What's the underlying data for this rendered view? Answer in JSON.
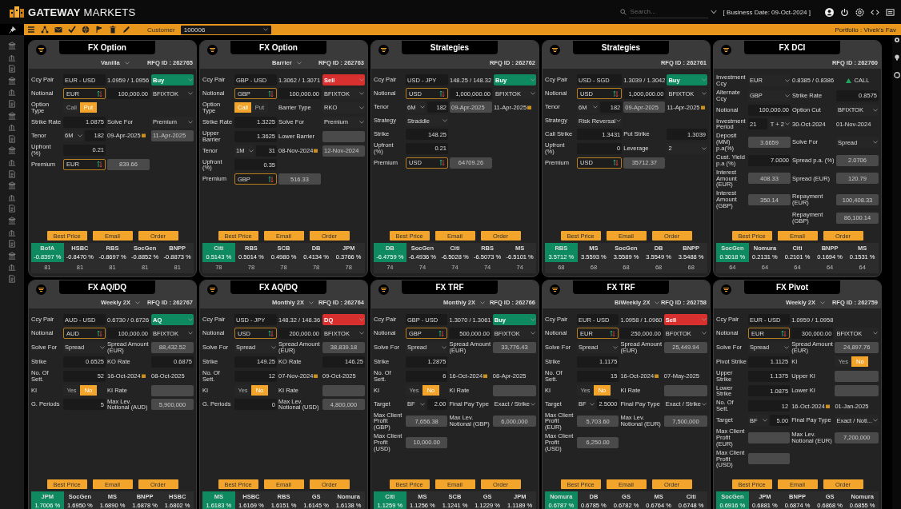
{
  "app": {
    "brand": "**GATEWAY** MARKETS",
    "search": {
      "placeholder": "Search..."
    },
    "business_date": "[ Business Date: 09-Oct-2024 ]"
  },
  "toolbar": {
    "customer_label": "Customer",
    "customer_value": "100006",
    "portfolio": "Portfolio : Vivek's Fav"
  },
  "cards": [
    {
      "title": "FX Option",
      "subtitle": "Vanilla",
      "rfq": "RFQ ID : 262765",
      "rows": [
        [
          {
            "kind": "label",
            "text": "Ccy Pair"
          },
          {
            "kind": "pair",
            "value": "EUR - USD"
          },
          {
            "kind": "text",
            "value": "1.0959 / 1.0956"
          },
          {
            "kind": "side",
            "value": "Buy",
            "color": "#0f8a60"
          }
        ],
        [
          {
            "kind": "label",
            "text": "Notional"
          },
          {
            "kind": "ccy",
            "value": "EUR"
          },
          {
            "kind": "input",
            "value": "100,000.00"
          },
          {
            "kind": "select",
            "value": "BFIXTOK"
          }
        ],
        [
          {
            "kind": "label",
            "text": "Option Type"
          },
          {
            "kind": "toggle",
            "options": [
              {
                "label": "Call",
                "selected": false
              },
              {
                "label": "Put",
                "selected": true
              }
            ]
          }
        ],
        [
          {
            "kind": "label",
            "text": "Strike Rate"
          },
          {
            "kind": "input",
            "value": "1.0875"
          },
          {
            "kind": "label",
            "text": "Solve For"
          },
          {
            "kind": "select",
            "value": "Premium"
          }
        ],
        [
          {
            "kind": "label",
            "text": "Tenor"
          },
          {
            "kind": "group",
            "parts": [
              {
                "kind": "select",
                "value": "6M"
              },
              {
                "kind": "input",
                "value": "182"
              }
            ]
          },
          {
            "kind": "date",
            "value": "09-Apr-2025"
          },
          {
            "kind": "datebox",
            "value": "11-Apr-2025"
          }
        ],
        [
          {
            "kind": "label",
            "text": "Upfront (%)"
          },
          {
            "kind": "input",
            "value": "0.21"
          }
        ],
        [
          {
            "kind": "label",
            "text": "Premium"
          },
          {
            "kind": "ccy",
            "value": "EUR"
          },
          {
            "kind": "readonly",
            "value": "839.66"
          }
        ]
      ],
      "buttons": [
        "Best Price",
        "Email",
        "Order"
      ],
      "quotes": [
        {
          "bank": "BofA",
          "rate": "-0.8397 %",
          "count": "81",
          "selected": true
        },
        {
          "bank": "HSBC",
          "rate": "-0.8470 %",
          "count": "81",
          "selected": false
        },
        {
          "bank": "RBS",
          "rate": "-0.8697 %",
          "count": "81",
          "selected": false
        },
        {
          "bank": "SocGen",
          "rate": "-0.8852 %",
          "count": "81",
          "selected": false
        },
        {
          "bank": "BNPP",
          "rate": "-0.8873 %",
          "count": "81",
          "selected": false
        }
      ]
    },
    {
      "title": "FX Option",
      "subtitle": "Barrier",
      "rfq": "RFQ ID : 262763",
      "rows": [
        [
          {
            "kind": "label",
            "text": "Ccy Pair"
          },
          {
            "kind": "pair",
            "value": "GBP - USD"
          },
          {
            "kind": "text",
            "value": "1.3062 / 1.3071"
          },
          {
            "kind": "side",
            "value": "Sell",
            "color": "#d8302e"
          }
        ],
        [
          {
            "kind": "label",
            "text": "Notional"
          },
          {
            "kind": "ccy",
            "value": "GBP"
          },
          {
            "kind": "input",
            "value": "100,000.00"
          },
          {
            "kind": "select",
            "value": "BFIXTOK"
          }
        ],
        [
          {
            "kind": "label",
            "text": "Option Type"
          },
          {
            "kind": "toggle",
            "options": [
              {
                "label": "Call",
                "selected": true
              },
              {
                "label": "Put",
                "selected": false
              }
            ]
          },
          {
            "kind": "label",
            "text": "Barrier Type"
          },
          {
            "kind": "select",
            "value": "RKO"
          }
        ],
        [
          {
            "kind": "label",
            "text": "Strike Rate"
          },
          {
            "kind": "input",
            "value": "1.3225"
          },
          {
            "kind": "label",
            "text": "Solve For"
          },
          {
            "kind": "select",
            "value": "Premium"
          }
        ],
        [
          {
            "kind": "label",
            "text": "Upper Barrier"
          },
          {
            "kind": "input",
            "value": "1.3625"
          },
          {
            "kind": "label",
            "text": "Lower Barrier"
          },
          {
            "kind": "readonly"
          }
        ],
        [
          {
            "kind": "label",
            "text": "Tenor"
          },
          {
            "kind": "group",
            "parts": [
              {
                "kind": "select",
                "value": "1M"
              },
              {
                "kind": "input",
                "value": "31"
              }
            ]
          },
          {
            "kind": "date",
            "value": "08-Nov-2024"
          },
          {
            "kind": "datebox",
            "value": "12-Nov-2024"
          }
        ],
        [
          {
            "kind": "label",
            "text": "Upfront (%)"
          },
          {
            "kind": "input",
            "value": "0.35"
          }
        ],
        [
          {
            "kind": "label",
            "text": "Premium"
          },
          {
            "kind": "ccy",
            "value": "GBP"
          },
          {
            "kind": "readonly",
            "value": "516.33"
          }
        ]
      ],
      "buttons": [
        "Best Price",
        "Email",
        "Order"
      ],
      "quotes": [
        {
          "bank": "Citi",
          "rate": "0.5143 %",
          "count": "78",
          "selected": true
        },
        {
          "bank": "RBS",
          "rate": "0.5014 %",
          "count": "78",
          "selected": false
        },
        {
          "bank": "SCB",
          "rate": "0.4980 %",
          "count": "78",
          "selected": false
        },
        {
          "bank": "DB",
          "rate": "0.4134 %",
          "count": "78",
          "selected": false
        },
        {
          "bank": "JPM",
          "rate": "0.3766 %",
          "count": "78",
          "selected": false
        }
      ]
    },
    {
      "title": "Strategies",
      "rfq": "RFQ ID : 262762",
      "rows": [
        [
          {
            "kind": "label",
            "text": "Ccy Pair"
          },
          {
            "kind": "pair",
            "value": "USD - JPY"
          },
          {
            "kind": "text",
            "value": "148.25 / 148.32"
          },
          {
            "kind": "side",
            "value": "Buy",
            "color": "#0f8a60"
          }
        ],
        [
          {
            "kind": "label",
            "text": "Notional"
          },
          {
            "kind": "ccy",
            "value": "USD"
          },
          {
            "kind": "input",
            "value": "1,000,000.00"
          },
          {
            "kind": "select",
            "value": "BFIXTOK"
          }
        ],
        [
          {
            "kind": "label",
            "text": "Tenor"
          },
          {
            "kind": "group",
            "parts": [
              {
                "kind": "select",
                "value": "6M"
              },
              {
                "kind": "input",
                "value": "182"
              }
            ]
          },
          {
            "kind": "datebox",
            "value": "09-Apr-2025"
          },
          {
            "kind": "date",
            "value": "11-Apr-2025"
          }
        ],
        [
          {
            "kind": "label",
            "text": "Strategy"
          },
          {
            "kind": "select",
            "value": "Straddle"
          }
        ],
        [
          {
            "kind": "label",
            "text": "Strike"
          },
          {
            "kind": "input",
            "value": "148.25"
          }
        ],
        [
          {
            "kind": "label",
            "text": "Upfront (%)"
          },
          {
            "kind": "input",
            "value": "0.21"
          }
        ],
        [
          {
            "kind": "label",
            "text": "Premium"
          },
          {
            "kind": "ccy",
            "value": "USD"
          },
          {
            "kind": "readonly",
            "value": "64709.26"
          }
        ]
      ],
      "buttons": [
        "Best Price",
        "Email",
        "Order"
      ],
      "quotes": [
        {
          "bank": "DB",
          "rate": "-6.4759 %",
          "count": "74",
          "selected": true
        },
        {
          "bank": "SocGen",
          "rate": "-6.4936 %",
          "count": "74",
          "selected": false
        },
        {
          "bank": "Citi",
          "rate": "-6.5028 %",
          "count": "74",
          "selected": false
        },
        {
          "bank": "RBS",
          "rate": "-6.5073 %",
          "count": "74",
          "selected": false
        },
        {
          "bank": "MS",
          "rate": "-6.5101 %",
          "count": "74",
          "selected": false
        }
      ]
    },
    {
      "title": "Strategies",
      "rfq": "RFQ ID : 262761",
      "rows": [
        [
          {
            "kind": "label",
            "text": "Ccy Pair"
          },
          {
            "kind": "pair",
            "value": "USD - SGD"
          },
          {
            "kind": "text",
            "value": "1.3039 / 1.3042"
          },
          {
            "kind": "side",
            "value": "Buy",
            "color": "#0f8a60"
          }
        ],
        [
          {
            "kind": "label",
            "text": "Notional"
          },
          {
            "kind": "ccy",
            "value": "USD"
          },
          {
            "kind": "input",
            "value": "1,000,000.00"
          },
          {
            "kind": "select",
            "value": "BFIXTOK"
          }
        ],
        [
          {
            "kind": "label",
            "text": "Tenor"
          },
          {
            "kind": "group",
            "parts": [
              {
                "kind": "select",
                "value": "6M"
              },
              {
                "kind": "input",
                "value": "182"
              }
            ]
          },
          {
            "kind": "datebox",
            "value": "09-Apr-2025"
          },
          {
            "kind": "date",
            "value": "11-Apr-2025"
          }
        ],
        [
          {
            "kind": "label",
            "text": "Strategy"
          },
          {
            "kind": "select",
            "value": "Risk Reversal"
          }
        ],
        [
          {
            "kind": "label",
            "text": "Call Strike"
          },
          {
            "kind": "input",
            "value": "1.3431"
          },
          {
            "kind": "label",
            "text": "Put Strike"
          },
          {
            "kind": "input",
            "value": "1.3039"
          }
        ],
        [
          {
            "kind": "label",
            "text": "Upfront (%)"
          },
          {
            "kind": "input",
            "value": "0"
          },
          {
            "kind": "label",
            "text": "Leverage"
          },
          {
            "kind": "select",
            "value": "2"
          }
        ],
        [
          {
            "kind": "label",
            "text": "Premium"
          },
          {
            "kind": "ccy",
            "value": "USD"
          },
          {
            "kind": "readonly",
            "value": "35712.37"
          }
        ]
      ],
      "buttons": [
        "Best Price",
        "Email",
        "Order"
      ],
      "quotes": [
        {
          "bank": "RBS",
          "rate": "3.5712 %",
          "count": "68",
          "selected": true
        },
        {
          "bank": "MS",
          "rate": "3.5593 %",
          "count": "68",
          "selected": false
        },
        {
          "bank": "SocGen",
          "rate": "3.5589 %",
          "count": "68",
          "selected": false
        },
        {
          "bank": "DB",
          "rate": "3.5549 %",
          "count": "68",
          "selected": false
        },
        {
          "bank": "BNPP",
          "rate": "3.5488 %",
          "count": "68",
          "selected": false
        }
      ]
    },
    {
      "title": "FX DCI",
      "rfq": "RFQ ID : 262760",
      "rows": [
        [
          {
            "kind": "label",
            "text": "Investment Ccy"
          },
          {
            "kind": "select",
            "value": "EUR"
          },
          {
            "kind": "text",
            "value": "0.8385 / 0.8386"
          },
          {
            "kind": "call",
            "value": "CALL"
          }
        ],
        [
          {
            "kind": "label",
            "text": "Alternate Ccy"
          },
          {
            "kind": "select",
            "value": "GBP"
          },
          {
            "kind": "label",
            "text": "Strike Rate"
          },
          {
            "kind": "input",
            "value": "0.8575"
          }
        ],
        [
          {
            "kind": "label",
            "text": "Notional"
          },
          {
            "kind": "input",
            "value": "100,000.00"
          },
          {
            "kind": "label",
            "text": "Option Cut"
          },
          {
            "kind": "select",
            "value": "BFIXTOK"
          }
        ],
        [
          {
            "kind": "label",
            "text": "Investment Period"
          },
          {
            "kind": "group",
            "parts": [
              {
                "kind": "pair",
                "value": "21"
              },
              {
                "kind": "select",
                "value": "T + 2"
              }
            ]
          },
          {
            "kind": "text",
            "value": "30-Oct-2024"
          },
          {
            "kind": "text",
            "value": "01-Nov-2024"
          }
        ],
        [
          {
            "kind": "label",
            "text": "Deposit (MM) p.a(%)"
          },
          {
            "kind": "readonly",
            "value": "3.6659"
          },
          {
            "kind": "label",
            "text": "Solve For"
          },
          {
            "kind": "select",
            "value": "Spread"
          }
        ],
        [
          {
            "kind": "label",
            "text": "Cust. Yield p.a (%)"
          },
          {
            "kind": "input",
            "value": "7.0000"
          },
          {
            "kind": "label",
            "text": "Spread p.a. (%)"
          },
          {
            "kind": "readonly",
            "value": "2.0706"
          }
        ],
        [
          {
            "kind": "label",
            "text": "Interest Amount",
            "sub": "(EUR)"
          },
          {
            "kind": "readonly",
            "value": "408.33"
          },
          {
            "kind": "label",
            "text": "Spread",
            "sub": "(EUR)"
          },
          {
            "kind": "readonly",
            "value": "120.79"
          }
        ],
        [
          {
            "kind": "label",
            "text": "Interest Amount",
            "sub": "(GBP)"
          },
          {
            "kind": "readonly",
            "value": "350.14"
          },
          {
            "kind": "label",
            "text": "Repayment",
            "sub": "(EUR)"
          },
          {
            "kind": "readonly",
            "value": "100,408.33"
          }
        ],
        [
          {
            "kind": "blank"
          },
          {
            "kind": "blank"
          },
          {
            "kind": "label",
            "text": "Repayment",
            "sub": "(GBP)"
          },
          {
            "kind": "readonly",
            "value": "86,100.14"
          }
        ]
      ],
      "buttons": [
        "Best Price",
        "Email",
        "Order"
      ],
      "quotes": [
        {
          "bank": "SocGen",
          "rate": "0.3018 %",
          "count": "64",
          "selected": true
        },
        {
          "bank": "Nomura",
          "rate": "0.2131 %",
          "count": "64",
          "selected": false
        },
        {
          "bank": "Citi",
          "rate": "0.2101 %",
          "count": "64",
          "selected": false
        },
        {
          "bank": "BNPP",
          "rate": "0.1694 %",
          "count": "64",
          "selected": false
        },
        {
          "bank": "MS",
          "rate": "0.1531 %",
          "count": "64",
          "selected": false
        }
      ]
    },
    {
      "title": "FX AQ/DQ",
      "subtitle": "Weekly 2X",
      "rfq": "RFQ ID : 262767",
      "rows": [
        [
          {
            "kind": "label",
            "text": "Ccy Pair"
          },
          {
            "kind": "pair",
            "value": "AUD - USD"
          },
          {
            "kind": "text",
            "value": "0.6730 / 0.6726"
          },
          {
            "kind": "side",
            "value": "AQ",
            "color": "#0f8a60"
          }
        ],
        [
          {
            "kind": "label",
            "text": "Notional"
          },
          {
            "kind": "ccy",
            "value": "AUD"
          },
          {
            "kind": "input",
            "value": "100,000.00"
          },
          {
            "kind": "select",
            "value": "BFIXTOK"
          }
        ],
        [
          {
            "kind": "label",
            "text": "Solve For"
          },
          {
            "kind": "select",
            "value": "Spread"
          },
          {
            "kind": "label",
            "text": "Spread Amount",
            "sub": "(EUR)"
          },
          {
            "kind": "readonly",
            "value": "88,432.52"
          }
        ],
        [
          {
            "kind": "label",
            "text": "Strike"
          },
          {
            "kind": "input",
            "value": "0.6525"
          },
          {
            "kind": "label",
            "text": "KO Rate"
          },
          {
            "kind": "input",
            "value": "0.6875"
          }
        ],
        [
          {
            "kind": "label",
            "text": "No. Of Sett."
          },
          {
            "kind": "input",
            "value": "52"
          },
          {
            "kind": "date",
            "value": "16-Oct-2024"
          },
          {
            "kind": "text",
            "value": "08-Oct-2025"
          }
        ],
        [
          {
            "kind": "label",
            "text": "KI"
          },
          {
            "kind": "toggle",
            "options": [
              {
                "label": "Yes",
                "selected": false
              },
              {
                "label": "No",
                "selected": true
              }
            ]
          },
          {
            "kind": "label",
            "text": "KI Rate"
          },
          {
            "kind": "readonly"
          }
        ],
        [
          {
            "kind": "label",
            "text": "G. Periods"
          },
          {
            "kind": "input",
            "value": "5"
          },
          {
            "kind": "label",
            "text": "Max Lev. Notional",
            "sub": "(AUD)"
          },
          {
            "kind": "readonly",
            "value": "5,900,000"
          }
        ]
      ],
      "buttons": [
        "Best Price",
        "Email",
        "Order"
      ],
      "quotes": [
        {
          "bank": "JPM",
          "rate": "1.7006 %",
          "selected": true
        },
        {
          "bank": "SocGen",
          "rate": "1.6950 %",
          "selected": false
        },
        {
          "bank": "MS",
          "rate": "1.6890 %",
          "selected": false
        },
        {
          "bank": "BNPP",
          "rate": "1.6878 %",
          "selected": false
        },
        {
          "bank": "HSBC",
          "rate": "1.6802 %",
          "selected": false
        }
      ]
    },
    {
      "title": "FX AQ/DQ",
      "subtitle": "Monthly 2X",
      "rfq": "RFQ ID : 262764",
      "rows": [
        [
          {
            "kind": "label",
            "text": "Ccy Pair"
          },
          {
            "kind": "pair",
            "value": "USD - JPY"
          },
          {
            "kind": "text",
            "value": "148.32 / 148.36"
          },
          {
            "kind": "side",
            "value": "DQ",
            "color": "#d8302e"
          }
        ],
        [
          {
            "kind": "label",
            "text": "Notional"
          },
          {
            "kind": "ccy",
            "value": "USD"
          },
          {
            "kind": "input",
            "value": "200,000.00"
          },
          {
            "kind": "select",
            "value": "BFIXTOK"
          }
        ],
        [
          {
            "kind": "label",
            "text": "Solve For"
          },
          {
            "kind": "select",
            "value": "Spread"
          },
          {
            "kind": "label",
            "text": "Spread Amount",
            "sub": "(EUR)"
          },
          {
            "kind": "readonly",
            "value": "38,839.18"
          }
        ],
        [
          {
            "kind": "label",
            "text": "Strike"
          },
          {
            "kind": "input",
            "value": "149.25"
          },
          {
            "kind": "label",
            "text": "KO Rate"
          },
          {
            "kind": "input",
            "value": "146.25"
          }
        ],
        [
          {
            "kind": "label",
            "text": "No. Of Sett."
          },
          {
            "kind": "input",
            "value": "12"
          },
          {
            "kind": "date",
            "value": "07-Nov-2024"
          },
          {
            "kind": "text",
            "value": "09-Oct-2025"
          }
        ],
        [
          {
            "kind": "label",
            "text": "KI"
          },
          {
            "kind": "toggle",
            "options": [
              {
                "label": "Yes",
                "selected": false
              },
              {
                "label": "No",
                "selected": true
              }
            ]
          },
          {
            "kind": "label",
            "text": "KI Rate"
          },
          {
            "kind": "readonly"
          }
        ],
        [
          {
            "kind": "label",
            "text": "G. Periods"
          },
          {
            "kind": "input",
            "value": "0"
          },
          {
            "kind": "label",
            "text": "Max Lev. Notional",
            "sub": "(USD)"
          },
          {
            "kind": "readonly",
            "value": "4,800,000"
          }
        ]
      ],
      "buttons": [
        "Best Price",
        "Email",
        "Order"
      ],
      "quotes": [
        {
          "bank": "MS",
          "rate": "1.6183 %",
          "selected": true
        },
        {
          "bank": "HSBC",
          "rate": "1.6169 %",
          "selected": false
        },
        {
          "bank": "RBS",
          "rate": "1.6151 %",
          "selected": false
        },
        {
          "bank": "GS",
          "rate": "1.6145 %",
          "selected": false
        },
        {
          "bank": "Nomura",
          "rate": "1.6138 %",
          "selected": false
        }
      ]
    },
    {
      "title": "FX TRF",
      "subtitle": "Monthly 2X",
      "rfq": "RFQ ID : 262766",
      "rows": [
        [
          {
            "kind": "label",
            "text": "Ccy Pair"
          },
          {
            "kind": "pair",
            "value": "GBP - USD"
          },
          {
            "kind": "text",
            "value": "1.3070 / 1.3061"
          },
          {
            "kind": "side",
            "value": "Buy",
            "color": "#0f8a60"
          }
        ],
        [
          {
            "kind": "label",
            "text": "Notional"
          },
          {
            "kind": "ccy",
            "value": "GBP"
          },
          {
            "kind": "input",
            "value": "500,000.00"
          },
          {
            "kind": "select",
            "value": "BFIXTOK"
          }
        ],
        [
          {
            "kind": "label",
            "text": "Solve For"
          },
          {
            "kind": "select",
            "value": "Spread"
          },
          {
            "kind": "label",
            "text": "Spread Amount",
            "sub": "(EUR)"
          },
          {
            "kind": "readonly",
            "value": "33,776.43"
          }
        ],
        [
          {
            "kind": "label",
            "text": "Strike"
          },
          {
            "kind": "input",
            "value": "1.2875"
          }
        ],
        [
          {
            "kind": "label",
            "text": "No. Of Sett."
          },
          {
            "kind": "input",
            "value": "6"
          },
          {
            "kind": "date",
            "value": "16-Oct-2024"
          },
          {
            "kind": "text",
            "value": "08-Apr-2025"
          }
        ],
        [
          {
            "kind": "label",
            "text": "KI"
          },
          {
            "kind": "toggle",
            "options": [
              {
                "label": "Yes",
                "selected": false
              },
              {
                "label": "No",
                "selected": true
              }
            ]
          },
          {
            "kind": "label",
            "text": "KI Rate"
          },
          {
            "kind": "readonly"
          }
        ],
        [
          {
            "kind": "label",
            "text": "Target"
          },
          {
            "kind": "group",
            "parts": [
              {
                "kind": "select",
                "value": "BF"
              },
              {
                "kind": "input",
                "value": "2.00"
              }
            ]
          },
          {
            "kind": "label",
            "text": "Final Pay Type"
          },
          {
            "kind": "select",
            "value": "Exact / Strike"
          }
        ],
        [
          {
            "kind": "label",
            "text": "Max Client Profit",
            "sub": "(GBP)"
          },
          {
            "kind": "readonly",
            "value": "7,656.38"
          },
          {
            "kind": "label",
            "text": "Max Lev. Notional",
            "sub": "(GBP)"
          },
          {
            "kind": "readonly",
            "value": "6,000,000"
          }
        ],
        [
          {
            "kind": "label",
            "text": "Max Client Profit",
            "sub": "(USD)"
          },
          {
            "kind": "readonly",
            "value": "10,000.00"
          }
        ]
      ],
      "buttons": [
        "Best Price",
        "Email",
        "Order"
      ],
      "quotes": [
        {
          "bank": "Citi",
          "rate": "1.1259 %",
          "selected": true
        },
        {
          "bank": "MS",
          "rate": "1.1256 %",
          "selected": false
        },
        {
          "bank": "SCB",
          "rate": "1.1241 %",
          "selected": false
        },
        {
          "bank": "GS",
          "rate": "1.1229 %",
          "selected": false
        },
        {
          "bank": "JPM",
          "rate": "1.1189 %",
          "selected": false
        }
      ]
    },
    {
      "title": "FX TRF",
      "subtitle": "BiWeekly 2X",
      "rfq": "RFQ ID : 262758",
      "rows": [
        [
          {
            "kind": "label",
            "text": "Ccy Pair"
          },
          {
            "kind": "pair",
            "value": "EUR - USD"
          },
          {
            "kind": "text",
            "value": "1.0958 / 1.0960"
          },
          {
            "kind": "side",
            "value": "Sell",
            "color": "#d8302e"
          }
        ],
        [
          {
            "kind": "label",
            "text": "Notional"
          },
          {
            "kind": "ccy",
            "value": "EUR"
          },
          {
            "kind": "input",
            "value": "250,000.00"
          },
          {
            "kind": "select",
            "value": "BFIXTOK"
          }
        ],
        [
          {
            "kind": "label",
            "text": "Solve For"
          },
          {
            "kind": "select",
            "value": "Spread"
          },
          {
            "kind": "label",
            "text": "Spread Amount",
            "sub": "(EUR)"
          },
          {
            "kind": "readonly",
            "value": "25,449.94"
          }
        ],
        [
          {
            "kind": "label",
            "text": "Strike"
          },
          {
            "kind": "input",
            "value": "1.1175"
          }
        ],
        [
          {
            "kind": "label",
            "text": "No. Of Sett."
          },
          {
            "kind": "input",
            "value": "15"
          },
          {
            "kind": "date",
            "value": "16-Oct-2024"
          },
          {
            "kind": "text",
            "value": "07-May-2025"
          }
        ],
        [
          {
            "kind": "label",
            "text": "KI"
          },
          {
            "kind": "toggle",
            "options": [
              {
                "label": "Yes",
                "selected": false
              },
              {
                "label": "No",
                "selected": true
              }
            ]
          },
          {
            "kind": "label",
            "text": "KI Rate"
          },
          {
            "kind": "readonly"
          }
        ],
        [
          {
            "kind": "label",
            "text": "Target"
          },
          {
            "kind": "group",
            "parts": [
              {
                "kind": "select",
                "value": "BF"
              },
              {
                "kind": "input",
                "value": "2.5000"
              }
            ]
          },
          {
            "kind": "label",
            "text": "Final Pay Type"
          },
          {
            "kind": "select",
            "value": "Exact / Strike"
          }
        ],
        [
          {
            "kind": "label",
            "text": "Max Client Profit",
            "sub": "(EUR)"
          },
          {
            "kind": "readonly",
            "value": "5,703.60"
          },
          {
            "kind": "label",
            "text": "Max Lev. Notional",
            "sub": "(EUR)"
          },
          {
            "kind": "readonly",
            "value": "7,500,000"
          }
        ],
        [
          {
            "kind": "label",
            "text": "Max Client Profit",
            "sub": "(USD)"
          },
          {
            "kind": "readonly",
            "value": "6,250.00"
          }
        ]
      ],
      "buttons": [
        "Best Price",
        "Email",
        "Order"
      ],
      "quotes": [
        {
          "bank": "Nomura",
          "rate": "0.6787 %",
          "selected": true
        },
        {
          "bank": "DB",
          "rate": "0.6785 %",
          "selected": false
        },
        {
          "bank": "GS",
          "rate": "0.6782 %",
          "selected": false
        },
        {
          "bank": "MS",
          "rate": "0.6764 %",
          "selected": false
        },
        {
          "bank": "Citi",
          "rate": "0.6748 %",
          "selected": false
        }
      ]
    },
    {
      "title": "FX Pivot",
      "subtitle": "Weekly 2X",
      "rfq": "RFQ ID : 262759",
      "rows": [
        [
          {
            "kind": "label",
            "text": "Ccy Pair"
          },
          {
            "kind": "pair",
            "value": "EUR - USD"
          },
          {
            "kind": "text",
            "value": "1.0959 / 1.0958"
          }
        ],
        [
          {
            "kind": "label",
            "text": "Notional"
          },
          {
            "kind": "ccy",
            "value": "EUR"
          },
          {
            "kind": "input",
            "value": "300,000.00"
          },
          {
            "kind": "select",
            "value": "BFIXTOK"
          }
        ],
        [
          {
            "kind": "label",
            "text": "Solve For"
          },
          {
            "kind": "select",
            "value": "Spread"
          },
          {
            "kind": "label",
            "text": "Spread Amount",
            "sub": "(EUR)"
          },
          {
            "kind": "readonly",
            "value": "24,897.76"
          }
        ],
        [
          {
            "kind": "label",
            "text": "Pivot Strike"
          },
          {
            "kind": "input",
            "value": "1.1125"
          },
          {
            "kind": "label",
            "text": "KI"
          },
          {
            "kind": "toggle",
            "options": [
              {
                "label": "Yes",
                "selected": false
              },
              {
                "label": "No",
                "selected": true
              }
            ]
          }
        ],
        [
          {
            "kind": "label",
            "text": "Upper Strike"
          },
          {
            "kind": "input",
            "value": "1.1375"
          },
          {
            "kind": "label",
            "text": "Upper KI"
          },
          {
            "kind": "readonly"
          }
        ],
        [
          {
            "kind": "label",
            "text": "Lower Strike"
          },
          {
            "kind": "input",
            "value": "1.0875"
          },
          {
            "kind": "label",
            "text": "Lower KI"
          },
          {
            "kind": "readonly"
          }
        ],
        [
          {
            "kind": "label",
            "text": "No. Of Sett."
          },
          {
            "kind": "input",
            "value": "12"
          },
          {
            "kind": "date",
            "value": "16-Oct-2024"
          },
          {
            "kind": "text",
            "value": "01-Jan-2025"
          }
        ],
        [
          {
            "kind": "label",
            "text": "Target"
          },
          {
            "kind": "group",
            "parts": [
              {
                "kind": "select",
                "value": "BF"
              },
              {
                "kind": "input",
                "value": "5.00"
              }
            ]
          },
          {
            "kind": "label",
            "text": "Final Pay Type"
          },
          {
            "kind": "select",
            "value": "Exact / Noti..."
          }
        ],
        [
          {
            "kind": "label",
            "text": "Max Client Profit",
            "sub": "(EUR)"
          },
          {
            "kind": "readonly"
          },
          {
            "kind": "label",
            "text": "Max Lev. Notional",
            "sub": "(EUR)"
          },
          {
            "kind": "readonly",
            "value": "7,200,000"
          }
        ],
        [
          {
            "kind": "label",
            "text": "Max Client Profit",
            "sub": "(USD)"
          },
          {
            "kind": "readonly"
          }
        ]
      ],
      "buttons": [
        "Best Price",
        "Email",
        "Order"
      ],
      "quotes": [
        {
          "bank": "SocGen",
          "rate": "0.6916 %",
          "selected": true
        },
        {
          "bank": "JPM",
          "rate": "0.6881 %",
          "selected": false
        },
        {
          "bank": "BNPP",
          "rate": "0.6874 %",
          "selected": false
        },
        {
          "bank": "GS",
          "rate": "0.6868 %",
          "selected": false
        },
        {
          "bank": "Nomura",
          "rate": "0.6855 %",
          "selected": false
        }
      ]
    }
  ]
}
